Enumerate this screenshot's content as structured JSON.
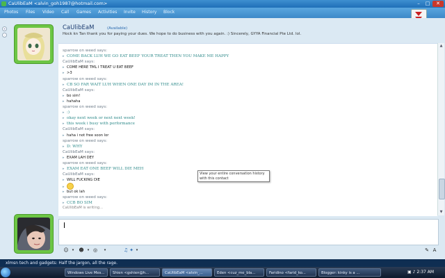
{
  "window": {
    "title": "CaUlibEaM <alvin_goh1987@hotmail.com>",
    "controls": {
      "minimize": "–",
      "maximize": "□",
      "close": "✕"
    }
  },
  "menu": {
    "items": [
      "Photos",
      "Files",
      "Video",
      "Call",
      "Games",
      "Activities",
      "Invite",
      "History",
      "Block"
    ]
  },
  "contact": {
    "name": "CaUlibEaM",
    "status": "(Available)",
    "personal_message": "Hock kn Tan thank you for paying your dues. We hope to do business with you again. :) Sincerely, GYYA Financial Pte Ltd. lol."
  },
  "conversation": [
    {
      "type": "who",
      "text": "sparrow on weed says:"
    },
    {
      "type": "msg",
      "style": "teal",
      "text": "COME BACK LUH WE GO EAT BEEF YOUR TREAT THEN YOU MAKE ME HAPPY"
    },
    {
      "type": "who",
      "text": "CaUlibEaM says:"
    },
    {
      "type": "msg",
      "style": "plain",
      "text": "COME HERE TML I TREAT U EAT BEEF"
    },
    {
      "type": "msg",
      "style": "plain",
      "text": ">3"
    },
    {
      "type": "who",
      "text": "sparrow on weed says:"
    },
    {
      "type": "msg",
      "style": "teal",
      "text": "CB SO FAR WAIT LUH WHEN ONE DAY IM IN THE AREA!"
    },
    {
      "type": "who",
      "text": "CaUlibEaM says:"
    },
    {
      "type": "msg",
      "style": "plain",
      "text": "bo sim!"
    },
    {
      "type": "msg",
      "style": "plain",
      "text": "hahaha"
    },
    {
      "type": "who",
      "text": "sparrow on weed says:"
    },
    {
      "type": "msg",
      "style": "teal",
      "text": ":)"
    },
    {
      "type": "msg",
      "style": "teal",
      "text": "okay next week or next next week!"
    },
    {
      "type": "msg",
      "style": "teal",
      "text": "this week i busy with performance"
    },
    {
      "type": "who",
      "text": "CaUlibEaM says:"
    },
    {
      "type": "msg",
      "style": "plain",
      "text": "haha i not free soon lor"
    },
    {
      "type": "who",
      "text": "sparrow on weed says:"
    },
    {
      "type": "msg",
      "style": "teal",
      "text": "D: WHY"
    },
    {
      "type": "who",
      "text": "CaUlibEaM says:"
    },
    {
      "type": "msg",
      "style": "plain",
      "text": "EXAM LAH DEY"
    },
    {
      "type": "who",
      "text": "sparrow on weed says:"
    },
    {
      "type": "msg",
      "style": "teal",
      "text": "EXAM EAT ONE BEEF WILL DIE MEH"
    },
    {
      "type": "who",
      "text": "CaUlibEaM says:"
    },
    {
      "type": "msg",
      "style": "plain",
      "text": "WILL FUCKING DIE"
    },
    {
      "type": "emoticon",
      "text": ""
    },
    {
      "type": "msg",
      "style": "plain",
      "text": "but ok lah"
    },
    {
      "type": "who",
      "text": "sparrow on weed says:"
    },
    {
      "type": "msg",
      "style": "teal",
      "text": "CCB BO SIM"
    }
  ],
  "typing_indicator": "CaUlibEaM is writing...",
  "tooltip": "View your entire conversation history with this contact",
  "ad_bar": "xlmsn tech and gadgets: Half the jargon, all the rage.",
  "taskbar": {
    "tasks": [
      {
        "label": "Windows Live Mes...",
        "active": false
      },
      {
        "label": "Shien <gshien@h...",
        "active": false
      },
      {
        "label": "CaUlibEaM <alvin_...",
        "active": true
      },
      {
        "label": "Eden <cuz_me_bla...",
        "active": false
      },
      {
        "label": "Faridino <farid_ko...",
        "active": false
      },
      {
        "label": "Blogger: kinky is a ...",
        "active": false
      }
    ],
    "clock": "2:37 AM"
  },
  "colors": {
    "accent": "#2f7cc1",
    "green_frame": "#6cc644",
    "teal_text": "#2e8a8a"
  }
}
